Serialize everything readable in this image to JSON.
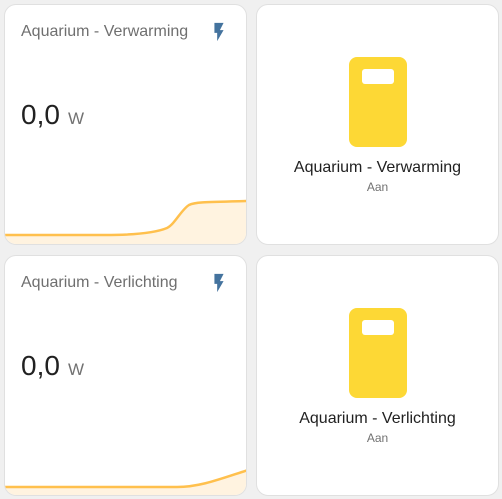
{
  "cards": [
    {
      "title": "Aquarium - Verwarming",
      "value": "0,0",
      "unit": "W",
      "icon": "flash-icon"
    },
    {
      "title": "Aquarium - Verlichting",
      "value": "0,0",
      "unit": "W",
      "icon": "flash-icon"
    }
  ],
  "switches": [
    {
      "name": "Aquarium - Verwarming",
      "state": "Aan",
      "icon": "power-socket-icon"
    },
    {
      "name": "Aquarium - Verlichting",
      "state": "Aan",
      "icon": "power-socket-icon"
    }
  ],
  "colors": {
    "accent_blue": "#44739e",
    "state_on_yellow": "#fdd835",
    "graph_line": "#ffc04d"
  }
}
